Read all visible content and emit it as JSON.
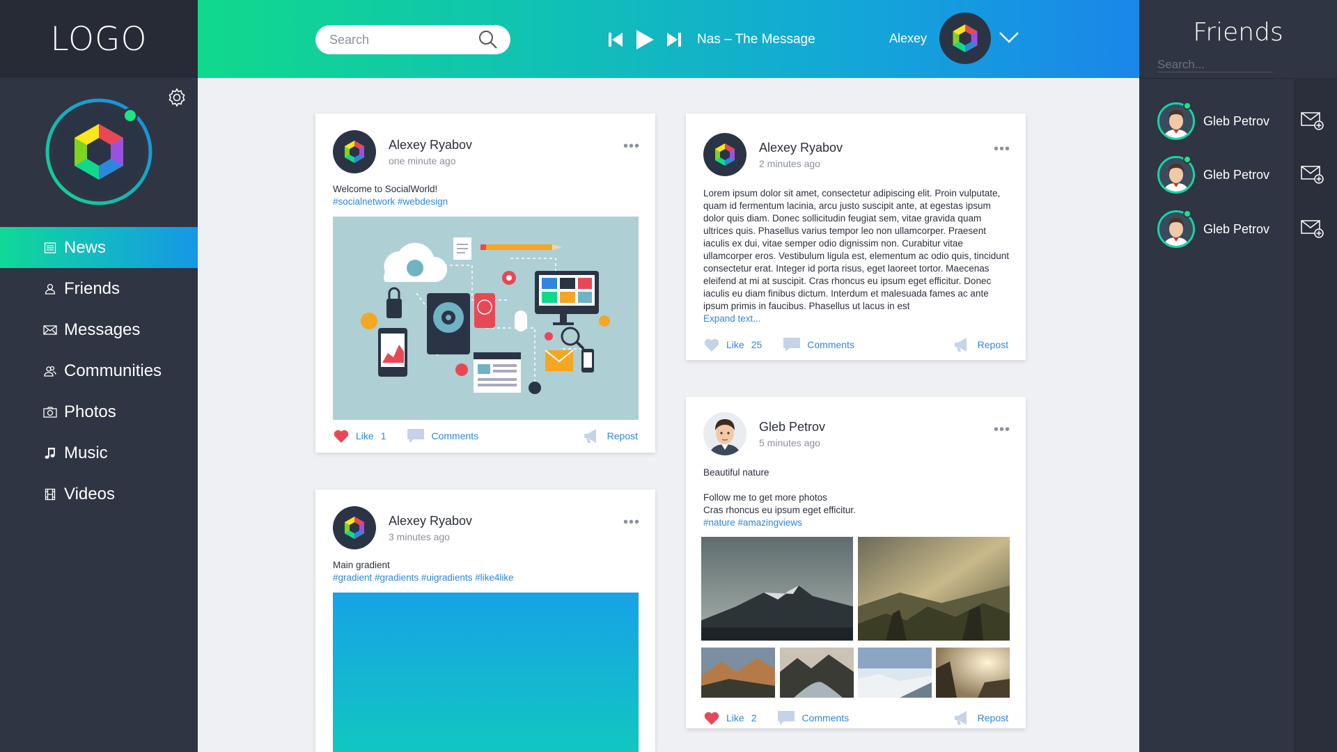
{
  "logo": "LOGO",
  "nav": [
    {
      "label": "News",
      "icon": "news-icon",
      "active": true
    },
    {
      "label": "Friends",
      "icon": "user-icon",
      "active": false
    },
    {
      "label": "Messages",
      "icon": "envelope-icon",
      "active": false
    },
    {
      "label": "Communities",
      "icon": "users-icon",
      "active": false
    },
    {
      "label": "Photos",
      "icon": "camera-icon",
      "active": false
    },
    {
      "label": "Music",
      "icon": "music-note-icon",
      "active": false
    },
    {
      "label": "Videos",
      "icon": "film-icon",
      "active": false
    }
  ],
  "search": {
    "placeholder": "Search"
  },
  "player": {
    "track": "Nas – The Message"
  },
  "user": {
    "name": "Alexey"
  },
  "friends_panel": {
    "title": "Friends",
    "search_placeholder": "Search...",
    "friends": [
      {
        "name": "Gleb Petrov"
      },
      {
        "name": "Gleb Petrov"
      },
      {
        "name": "Gleb Petrov"
      }
    ]
  },
  "actions": {
    "like": "Like",
    "comments": "Comments",
    "repost": "Repost"
  },
  "posts": [
    {
      "author": "Alexey Ryabov",
      "time": "one minute ago",
      "text": "Welcome to SocialWorld!",
      "tags": "#socialnetwork #webdesign",
      "likes": "1",
      "liked": true
    },
    {
      "author": "Alexey Ryabov",
      "time": "2 minutes ago",
      "text": "Lorem ipsum dolor sit amet, consectetur adipiscing elit. Proin vulputate, quam id fermentum lacinia, arcu justo suscipit ante, at egestas ipsum dolor quis diam. Donec sollicitudin feugiat sem, vitae gravida quam ultrices quis. Phasellus varius tempor leo non ullamcorper. Praesent iaculis ex dui, vitae semper odio dignissim non. Curabitur vitae ullamcorper eros. Vestibulum ligula est, elementum ac odio quis, tincidunt consectetur erat. Integer id porta risus, eget laoreet tortor. Maecenas eleifend at mi at suscipit. Cras rhoncus eu ipsum eget efficitur. Donec iaculis eu diam finibus dictum. Interdum et malesuada fames ac ante ipsum primis in faucibus. Phasellus ut lacus in est",
      "expand": "Expand text...",
      "likes": "25",
      "liked": false
    },
    {
      "author": "Alexey Ryabov",
      "time": "3 minutes ago",
      "text": "Main gradient",
      "tags": "#gradient #gradients #uigradients #like4like"
    },
    {
      "author": "Gleb Petrov",
      "time": "5 minutes ago",
      "text": "Beautiful nature",
      "text2": "Follow me to get more photos",
      "text3": "Cras rhoncus eu ipsum eget efficitur.",
      "tags": "#nature #amazingviews",
      "likes": "2",
      "liked": true
    }
  ],
  "colors": {
    "sidebar": "#2f3542",
    "accent_green": "#10d98c",
    "accent_blue": "#1a86ea",
    "link": "#2e86de",
    "like_red": "#e84855"
  }
}
